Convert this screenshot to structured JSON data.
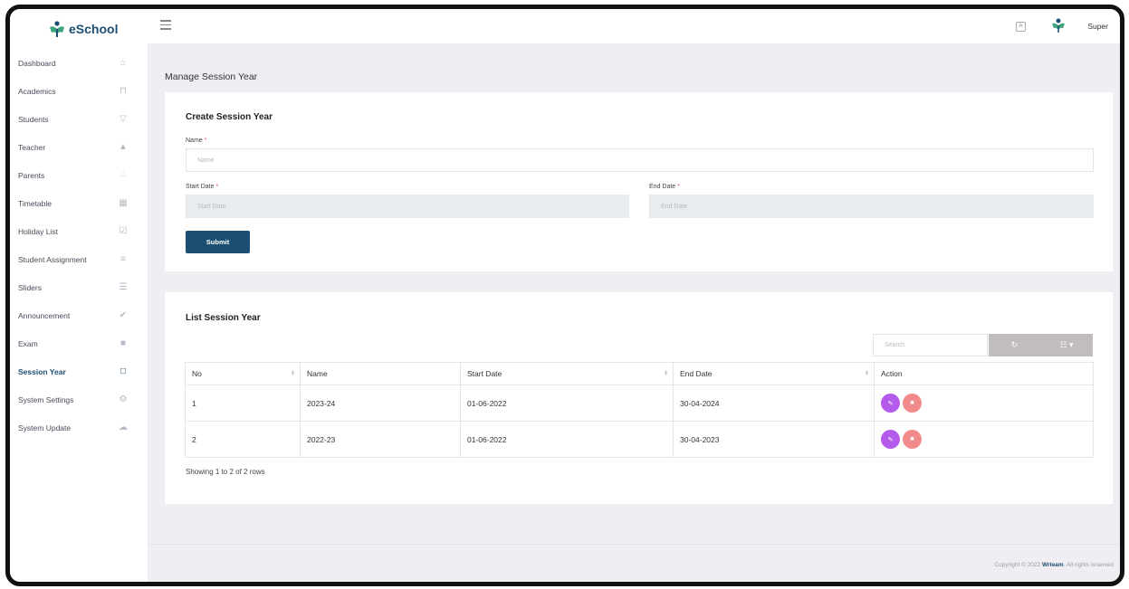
{
  "brand": {
    "name": "eSchool",
    "primary_color": "#1b4e72"
  },
  "sidebar": {
    "items": [
      {
        "label": "Dashboard",
        "icon": "home-icon",
        "glyph": "⌂"
      },
      {
        "label": "Academics",
        "icon": "institution-icon",
        "glyph": "⊓"
      },
      {
        "label": "Students",
        "icon": "graduation-cap-icon",
        "glyph": "▽"
      },
      {
        "label": "Teacher",
        "icon": "user-icon",
        "glyph": "▲"
      },
      {
        "label": "Parents",
        "icon": "users-icon",
        "glyph": "∴"
      },
      {
        "label": "Timetable",
        "icon": "calendar-icon",
        "glyph": "▦"
      },
      {
        "label": "Holiday List",
        "icon": "calendar-check-icon",
        "glyph": "☑"
      },
      {
        "label": "Student Assignment",
        "icon": "assignment-icon",
        "glyph": "≡"
      },
      {
        "label": "Sliders",
        "icon": "list-icon",
        "glyph": "☰"
      },
      {
        "label": "Announcement",
        "icon": "check-icon",
        "glyph": "✔"
      },
      {
        "label": "Exam",
        "icon": "book-icon",
        "glyph": "■"
      },
      {
        "label": "Session Year",
        "icon": "calendar-outline-icon",
        "glyph": "□",
        "active": true
      },
      {
        "label": "System Settings",
        "icon": "gear-icon",
        "glyph": "⚙"
      },
      {
        "label": "System Update",
        "icon": "cloud-upload-icon",
        "glyph": "☁"
      }
    ]
  },
  "header": {
    "user_name": "Super",
    "language_icon": "translate-icon",
    "avatar_icon": "user-avatar-icon"
  },
  "page": {
    "title": "Manage Session Year"
  },
  "create_form": {
    "title": "Create Session Year",
    "name_label": "Name",
    "name_placeholder": "Name",
    "start_label": "Start Date",
    "start_placeholder": "Start Date",
    "end_label": "End Date",
    "end_placeholder": "End Date",
    "required_mark": "*",
    "submit_label": "Submit"
  },
  "list": {
    "title": "List Session Year",
    "search_placeholder": "Search",
    "refresh_icon": "refresh-icon",
    "columns_icon": "columns-toggle-icon",
    "headers": [
      "No",
      "Name",
      "Start Date",
      "End Date",
      "Action"
    ],
    "rows": [
      {
        "no": "1",
        "name": "2023-24",
        "start": "01-06-2022",
        "end": "30-04-2024"
      },
      {
        "no": "2",
        "name": "2022-23",
        "start": "01-06-2022",
        "end": "30-04-2023"
      }
    ],
    "showing": "Showing 1 to 2 of 2 rows",
    "edit_color": "#b55bec",
    "delete_color": "#f28a8c"
  },
  "footer": {
    "prefix": "Copyright © 2022",
    "brand": "Wrteam",
    "suffix": ". All rights reserved"
  }
}
